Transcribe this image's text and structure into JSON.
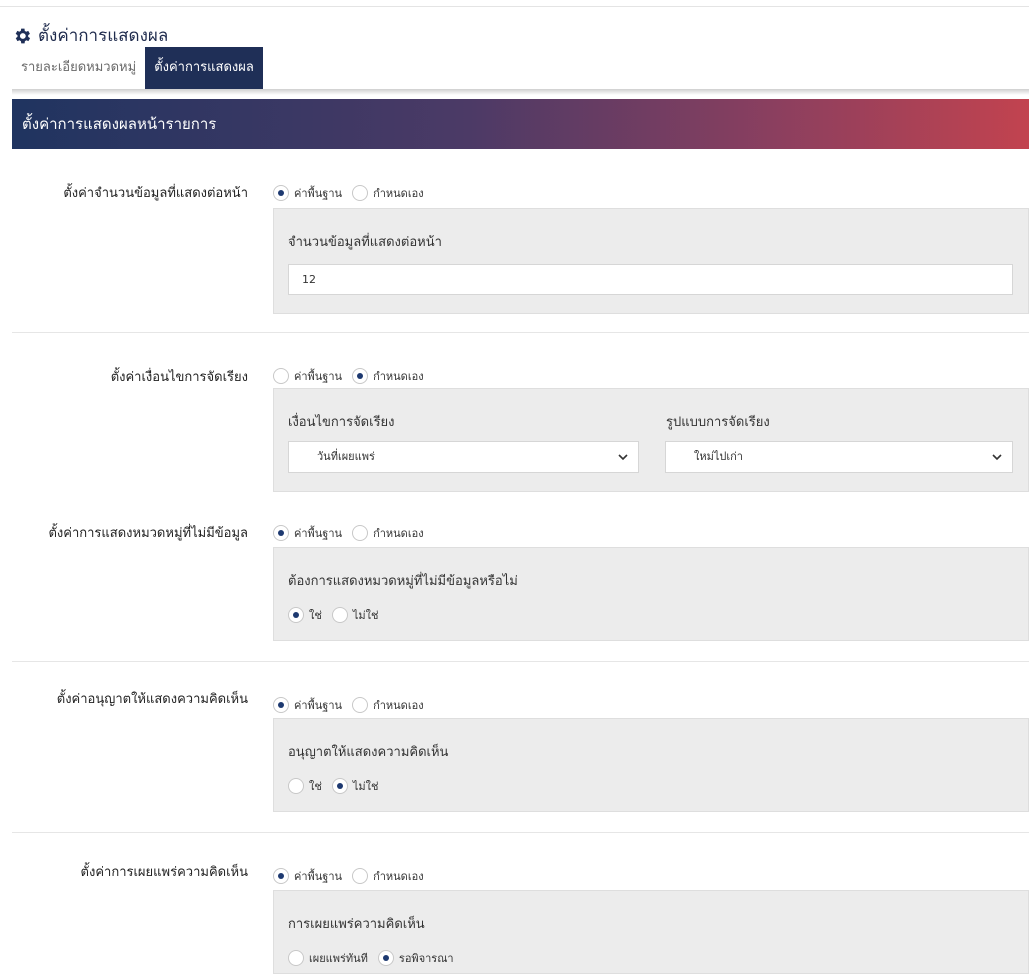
{
  "header": {
    "title": "ตั้งค่าการแสดงผล"
  },
  "tabs": [
    {
      "label": "รายละเอียดหมวดหมู่"
    },
    {
      "label": "ตั้งค่าการแสดงผล"
    }
  ],
  "banner": {
    "title": "ตั้งค่าการแสดงผลหน้ารายการ"
  },
  "mode_options": {
    "default": "ค่าพื้นฐาน",
    "custom": "กำหนดเอง"
  },
  "settings": {
    "per_page": {
      "label": "ตั้งค่าจำนวนข้อมูลที่แสดงต่อหน้า",
      "mode": "default",
      "field_label": "จำนวนข้อมูลที่แสดงต่อหน้า",
      "value": "12"
    },
    "sort": {
      "label": "ตั้งค่าเงื่อนไขการจัดเรียง",
      "mode": "custom",
      "condition_label": "เงื่อนไขการจัดเรียง",
      "condition_value": "วันที่เผยแพร่",
      "format_label": "รูปแบบการจัดเรียง",
      "format_value": "ใหม่ไปเก่า"
    },
    "empty_category": {
      "label": "ตั้งค่าการแสดงหมวดหมู่ที่ไม่มีข้อมูล",
      "mode": "default",
      "question": "ต้องการแสดงหมวดหมู่ที่ไม่มีข้อมูลหรือไม่",
      "options": [
        "ใช่",
        "ไม่ใช่"
      ],
      "selected": "ใช่"
    },
    "allow_comments": {
      "label": "ตั้งค่าอนุญาตให้แสดงความคิดเห็น",
      "mode": "default",
      "question": "อนุญาตให้แสดงความคิดเห็น",
      "options": [
        "ใช่",
        "ไม่ใช่"
      ],
      "selected": "ไม่ใช่"
    },
    "publish_comments": {
      "label": "ตั้งค่าการเผยแพร่ความคิดเห็น",
      "mode": "default",
      "question": "การเผยแพร่ความคิดเห็น",
      "options": [
        "เผยแพร่ทันที",
        "รอพิจารณา"
      ],
      "selected": "รอพิจารณา"
    }
  },
  "colors": {
    "navy": "#1f2f57",
    "banner_start": "#1f3460",
    "banner_end": "#c2434f",
    "panel": "#ececec"
  }
}
